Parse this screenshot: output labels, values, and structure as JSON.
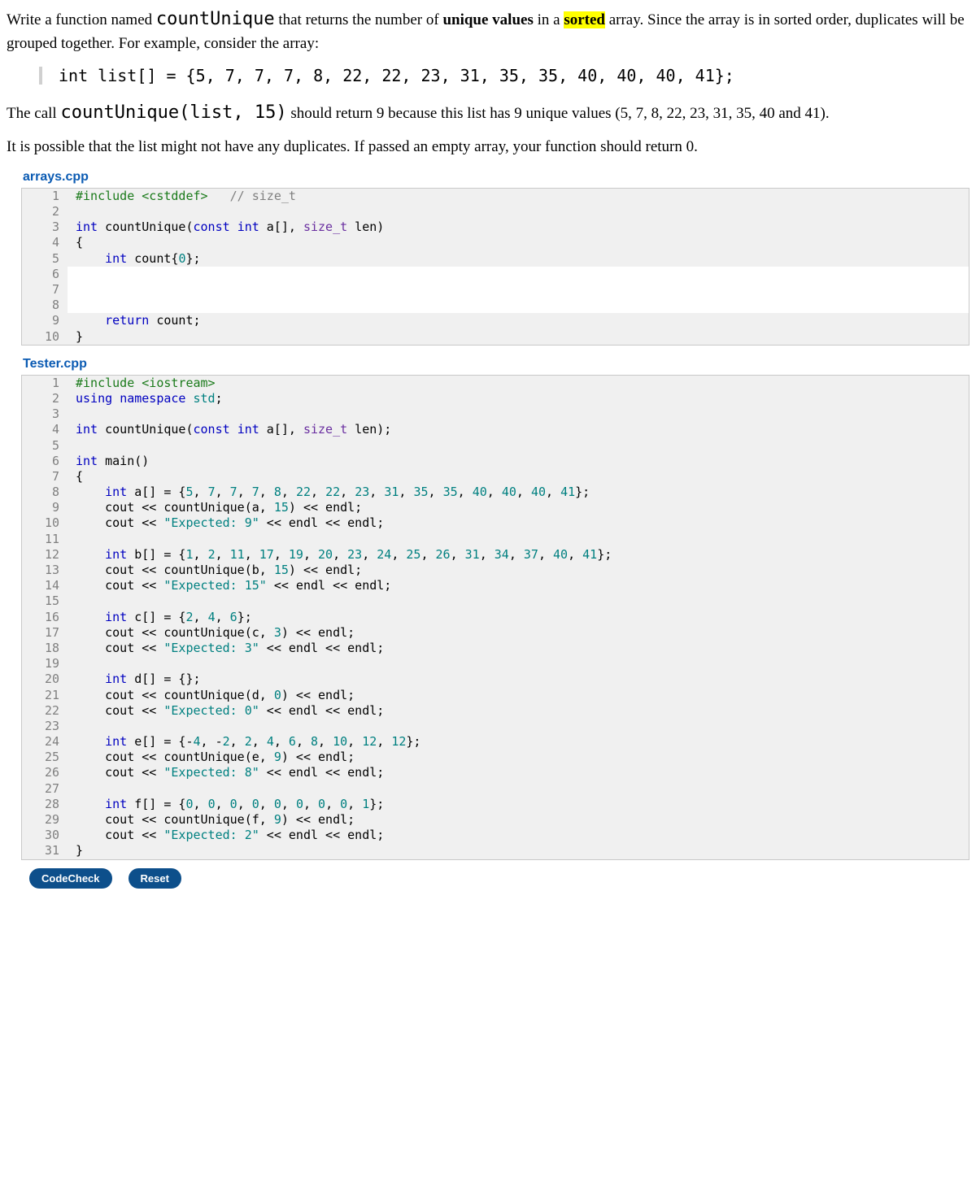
{
  "problem": {
    "p1_a": "Write a function named ",
    "fn_name": "countUnique",
    "p1_b": " that returns the number of ",
    "p1_bold": "unique values",
    "p1_c": " in a ",
    "p1_hl": "sorted",
    "p1_d": " array. Since the array is in sorted order, duplicates will be grouped together. For example, consider the array:",
    "example_code": "int list[] = {5, 7, 7, 7, 8, 22, 22, 23, 31, 35, 35, 40, 40, 40, 41};",
    "p2_a": "The call ",
    "call_code": "countUnique(list, 15)",
    "p2_b": " should return 9 because this list has 9 unique values (5, 7, 8, 22, 23, 31, 35, 40 and 41).",
    "p3": "It is possible that the list might not have any duplicates. If passed an empty array, your function should return 0."
  },
  "file1": {
    "name": "arrays.cpp",
    "lines": [
      {
        "n": "1",
        "grey": true,
        "tokens": [
          [
            "pp",
            "#include <cstddef>"
          ],
          [
            "plain",
            "   "
          ],
          [
            "cmt",
            "// size_t"
          ]
        ]
      },
      {
        "n": "2",
        "grey": true,
        "tokens": []
      },
      {
        "n": "3",
        "grey": true,
        "tokens": [
          [
            "kw",
            "int"
          ],
          [
            "plain",
            " countUnique("
          ],
          [
            "kw",
            "const"
          ],
          [
            "plain",
            " "
          ],
          [
            "kw",
            "int"
          ],
          [
            "plain",
            " a[], "
          ],
          [
            "ty",
            "size_t"
          ],
          [
            "plain",
            " len)"
          ]
        ]
      },
      {
        "n": "4",
        "grey": true,
        "tokens": [
          [
            "plain",
            "{"
          ]
        ]
      },
      {
        "n": "5",
        "grey": true,
        "tokens": [
          [
            "plain",
            "    "
          ],
          [
            "kw",
            "int"
          ],
          [
            "plain",
            " count{"
          ],
          [
            "num",
            "0"
          ],
          [
            "plain",
            "};"
          ]
        ]
      },
      {
        "n": "6",
        "grey": false,
        "tokens": []
      },
      {
        "n": "7",
        "grey": false,
        "tokens": []
      },
      {
        "n": "8",
        "grey": false,
        "tokens": []
      },
      {
        "n": "9",
        "grey": true,
        "tokens": [
          [
            "plain",
            "    "
          ],
          [
            "kw",
            "return"
          ],
          [
            "plain",
            " count;"
          ]
        ]
      },
      {
        "n": "10",
        "grey": true,
        "tokens": [
          [
            "plain",
            "}"
          ]
        ]
      }
    ]
  },
  "file2": {
    "name": "Tester.cpp",
    "lines": [
      {
        "n": "1",
        "tokens": [
          [
            "pp",
            "#include <iostream>"
          ]
        ]
      },
      {
        "n": "2",
        "tokens": [
          [
            "kw",
            "using"
          ],
          [
            "plain",
            " "
          ],
          [
            "kw",
            "namespace"
          ],
          [
            "plain",
            " "
          ],
          [
            "ns",
            "std"
          ],
          [
            "plain",
            ";"
          ]
        ]
      },
      {
        "n": "3",
        "tokens": []
      },
      {
        "n": "4",
        "tokens": [
          [
            "kw",
            "int"
          ],
          [
            "plain",
            " countUnique("
          ],
          [
            "kw",
            "const"
          ],
          [
            "plain",
            " "
          ],
          [
            "kw",
            "int"
          ],
          [
            "plain",
            " a[], "
          ],
          [
            "ty",
            "size_t"
          ],
          [
            "plain",
            " len);"
          ]
        ]
      },
      {
        "n": "5",
        "tokens": []
      },
      {
        "n": "6",
        "tokens": [
          [
            "kw",
            "int"
          ],
          [
            "plain",
            " main()"
          ]
        ]
      },
      {
        "n": "7",
        "tokens": [
          [
            "plain",
            "{"
          ]
        ]
      },
      {
        "n": "8",
        "tokens": [
          [
            "plain",
            "    "
          ],
          [
            "kw",
            "int"
          ],
          [
            "plain",
            " a[] = {"
          ],
          [
            "num",
            "5"
          ],
          [
            "plain",
            ", "
          ],
          [
            "num",
            "7"
          ],
          [
            "plain",
            ", "
          ],
          [
            "num",
            "7"
          ],
          [
            "plain",
            ", "
          ],
          [
            "num",
            "7"
          ],
          [
            "plain",
            ", "
          ],
          [
            "num",
            "8"
          ],
          [
            "plain",
            ", "
          ],
          [
            "num",
            "22"
          ],
          [
            "plain",
            ", "
          ],
          [
            "num",
            "22"
          ],
          [
            "plain",
            ", "
          ],
          [
            "num",
            "23"
          ],
          [
            "plain",
            ", "
          ],
          [
            "num",
            "31"
          ],
          [
            "plain",
            ", "
          ],
          [
            "num",
            "35"
          ],
          [
            "plain",
            ", "
          ],
          [
            "num",
            "35"
          ],
          [
            "plain",
            ", "
          ],
          [
            "num",
            "40"
          ],
          [
            "plain",
            ", "
          ],
          [
            "num",
            "40"
          ],
          [
            "plain",
            ", "
          ],
          [
            "num",
            "40"
          ],
          [
            "plain",
            ", "
          ],
          [
            "num",
            "41"
          ],
          [
            "plain",
            "};"
          ]
        ]
      },
      {
        "n": "9",
        "tokens": [
          [
            "plain",
            "    cout << countUnique(a, "
          ],
          [
            "num",
            "15"
          ],
          [
            "plain",
            ") << endl;"
          ]
        ]
      },
      {
        "n": "10",
        "tokens": [
          [
            "plain",
            "    cout << "
          ],
          [
            "str",
            "\"Expected: 9\""
          ],
          [
            "plain",
            " << endl << endl;"
          ]
        ]
      },
      {
        "n": "11",
        "tokens": []
      },
      {
        "n": "12",
        "tokens": [
          [
            "plain",
            "    "
          ],
          [
            "kw",
            "int"
          ],
          [
            "plain",
            " b[] = {"
          ],
          [
            "num",
            "1"
          ],
          [
            "plain",
            ", "
          ],
          [
            "num",
            "2"
          ],
          [
            "plain",
            ", "
          ],
          [
            "num",
            "11"
          ],
          [
            "plain",
            ", "
          ],
          [
            "num",
            "17"
          ],
          [
            "plain",
            ", "
          ],
          [
            "num",
            "19"
          ],
          [
            "plain",
            ", "
          ],
          [
            "num",
            "20"
          ],
          [
            "plain",
            ", "
          ],
          [
            "num",
            "23"
          ],
          [
            "plain",
            ", "
          ],
          [
            "num",
            "24"
          ],
          [
            "plain",
            ", "
          ],
          [
            "num",
            "25"
          ],
          [
            "plain",
            ", "
          ],
          [
            "num",
            "26"
          ],
          [
            "plain",
            ", "
          ],
          [
            "num",
            "31"
          ],
          [
            "plain",
            ", "
          ],
          [
            "num",
            "34"
          ],
          [
            "plain",
            ", "
          ],
          [
            "num",
            "37"
          ],
          [
            "plain",
            ", "
          ],
          [
            "num",
            "40"
          ],
          [
            "plain",
            ", "
          ],
          [
            "num",
            "41"
          ],
          [
            "plain",
            "};"
          ]
        ]
      },
      {
        "n": "13",
        "tokens": [
          [
            "plain",
            "    cout << countUnique(b, "
          ],
          [
            "num",
            "15"
          ],
          [
            "plain",
            ") << endl;"
          ]
        ]
      },
      {
        "n": "14",
        "tokens": [
          [
            "plain",
            "    cout << "
          ],
          [
            "str",
            "\"Expected: 15\""
          ],
          [
            "plain",
            " << endl << endl;"
          ]
        ]
      },
      {
        "n": "15",
        "tokens": []
      },
      {
        "n": "16",
        "tokens": [
          [
            "plain",
            "    "
          ],
          [
            "kw",
            "int"
          ],
          [
            "plain",
            " c[] = {"
          ],
          [
            "num",
            "2"
          ],
          [
            "plain",
            ", "
          ],
          [
            "num",
            "4"
          ],
          [
            "plain",
            ", "
          ],
          [
            "num",
            "6"
          ],
          [
            "plain",
            "};"
          ]
        ]
      },
      {
        "n": "17",
        "tokens": [
          [
            "plain",
            "    cout << countUnique(c, "
          ],
          [
            "num",
            "3"
          ],
          [
            "plain",
            ") << endl;"
          ]
        ]
      },
      {
        "n": "18",
        "tokens": [
          [
            "plain",
            "    cout << "
          ],
          [
            "str",
            "\"Expected: 3\""
          ],
          [
            "plain",
            " << endl << endl;"
          ]
        ]
      },
      {
        "n": "19",
        "tokens": []
      },
      {
        "n": "20",
        "tokens": [
          [
            "plain",
            "    "
          ],
          [
            "kw",
            "int"
          ],
          [
            "plain",
            " d[] = {};"
          ]
        ]
      },
      {
        "n": "21",
        "tokens": [
          [
            "plain",
            "    cout << countUnique(d, "
          ],
          [
            "num",
            "0"
          ],
          [
            "plain",
            ") << endl;"
          ]
        ]
      },
      {
        "n": "22",
        "tokens": [
          [
            "plain",
            "    cout << "
          ],
          [
            "str",
            "\"Expected: 0\""
          ],
          [
            "plain",
            " << endl << endl;"
          ]
        ]
      },
      {
        "n": "23",
        "tokens": []
      },
      {
        "n": "24",
        "tokens": [
          [
            "plain",
            "    "
          ],
          [
            "kw",
            "int"
          ],
          [
            "plain",
            " e[] = {-"
          ],
          [
            "num",
            "4"
          ],
          [
            "plain",
            ", -"
          ],
          [
            "num",
            "2"
          ],
          [
            "plain",
            ", "
          ],
          [
            "num",
            "2"
          ],
          [
            "plain",
            ", "
          ],
          [
            "num",
            "4"
          ],
          [
            "plain",
            ", "
          ],
          [
            "num",
            "6"
          ],
          [
            "plain",
            ", "
          ],
          [
            "num",
            "8"
          ],
          [
            "plain",
            ", "
          ],
          [
            "num",
            "10"
          ],
          [
            "plain",
            ", "
          ],
          [
            "num",
            "12"
          ],
          [
            "plain",
            ", "
          ],
          [
            "num",
            "12"
          ],
          [
            "plain",
            "};"
          ]
        ]
      },
      {
        "n": "25",
        "tokens": [
          [
            "plain",
            "    cout << countUnique(e, "
          ],
          [
            "num",
            "9"
          ],
          [
            "plain",
            ") << endl;"
          ]
        ]
      },
      {
        "n": "26",
        "tokens": [
          [
            "plain",
            "    cout << "
          ],
          [
            "str",
            "\"Expected: 8\""
          ],
          [
            "plain",
            " << endl << endl;"
          ]
        ]
      },
      {
        "n": "27",
        "tokens": []
      },
      {
        "n": "28",
        "tokens": [
          [
            "plain",
            "    "
          ],
          [
            "kw",
            "int"
          ],
          [
            "plain",
            " f[] = {"
          ],
          [
            "num",
            "0"
          ],
          [
            "plain",
            ", "
          ],
          [
            "num",
            "0"
          ],
          [
            "plain",
            ", "
          ],
          [
            "num",
            "0"
          ],
          [
            "plain",
            ", "
          ],
          [
            "num",
            "0"
          ],
          [
            "plain",
            ", "
          ],
          [
            "num",
            "0"
          ],
          [
            "plain",
            ", "
          ],
          [
            "num",
            "0"
          ],
          [
            "plain",
            ", "
          ],
          [
            "num",
            "0"
          ],
          [
            "plain",
            ", "
          ],
          [
            "num",
            "0"
          ],
          [
            "plain",
            ", "
          ],
          [
            "num",
            "1"
          ],
          [
            "plain",
            "};"
          ]
        ]
      },
      {
        "n": "29",
        "tokens": [
          [
            "plain",
            "    cout << countUnique(f, "
          ],
          [
            "num",
            "9"
          ],
          [
            "plain",
            ") << endl;"
          ]
        ]
      },
      {
        "n": "30",
        "tokens": [
          [
            "plain",
            "    cout << "
          ],
          [
            "str",
            "\"Expected: 2\""
          ],
          [
            "plain",
            " << endl << endl;"
          ]
        ]
      },
      {
        "n": "31",
        "tokens": [
          [
            "plain",
            "}"
          ]
        ]
      }
    ]
  },
  "buttons": {
    "codecheck": "CodeCheck",
    "reset": "Reset"
  }
}
